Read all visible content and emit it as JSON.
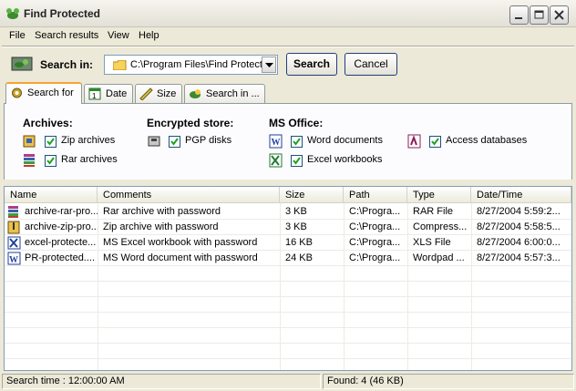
{
  "window": {
    "title": "Find Protected"
  },
  "menu": {
    "file": "File",
    "search_results": "Search results",
    "view": "View",
    "help": "Help"
  },
  "search": {
    "label": "Search in:",
    "path": "C:\\Program Files\\Find Protected",
    "search_button": "Search",
    "cancel_button": "Cancel"
  },
  "tabs": [
    {
      "label": "Search for",
      "icon": "gear-icon",
      "active": true
    },
    {
      "label": "Date",
      "icon": "calendar-icon",
      "active": false
    },
    {
      "label": "Size",
      "icon": "ruler-icon",
      "active": false
    },
    {
      "label": "Search in ...",
      "icon": "folder-search-icon",
      "active": false
    }
  ],
  "groups": {
    "archives": {
      "title": "Archives:",
      "items": [
        {
          "label": "Zip archives",
          "checked": true,
          "icon": "zip-archive-icon"
        },
        {
          "label": "Rar archives",
          "checked": true,
          "icon": "rar-archive-icon"
        }
      ]
    },
    "encrypted": {
      "title": "Encrypted store:",
      "items": [
        {
          "label": "PGP disks",
          "checked": true,
          "icon": "pgp-disk-icon"
        }
      ]
    },
    "office": {
      "title": "MS Office:",
      "items": [
        {
          "label": "Word documents",
          "checked": true,
          "icon": "word-icon"
        },
        {
          "label": "Excel workbooks",
          "checked": true,
          "icon": "excel-icon"
        },
        {
          "label": "Access databases",
          "checked": true,
          "icon": "access-icon"
        }
      ]
    }
  },
  "table": {
    "columns": [
      "Name",
      "Comments",
      "Size",
      "Path",
      "Type",
      "Date/Time"
    ],
    "rows": [
      {
        "name": "archive-rar-pro...",
        "comments": "Rar archive with password",
        "size": "3 KB",
        "path": "C:\\Progra...",
        "type": "RAR File",
        "datetime": "8/27/2004 5:59:2...",
        "icon": "rar-file-icon"
      },
      {
        "name": "archive-zip-pro...",
        "comments": "Zip archive with password",
        "size": "3 KB",
        "path": "C:\\Progra...",
        "type": "Compress...",
        "datetime": "8/27/2004 5:58:5...",
        "icon": "zip-file-icon"
      },
      {
        "name": "excel-protecte...",
        "comments": "MS Excel workbook with password",
        "size": "16 KB",
        "path": "C:\\Progra...",
        "type": "XLS File",
        "datetime": "8/27/2004 6:00:0...",
        "icon": "excel-file-icon"
      },
      {
        "name": "PR-protected....",
        "comments": "MS Word document with password",
        "size": "24 KB",
        "path": "C:\\Progra...",
        "type": "Wordpad ...",
        "datetime": "8/27/2004 5:57:3...",
        "icon": "word-file-icon"
      }
    ]
  },
  "status": {
    "search_time": "Search time : 12:00:00 AM",
    "found": "Found: 4  (46 KB)"
  },
  "colors": {
    "accent": "#f5a430",
    "window_bg": "#ece9d8",
    "border_blue": "#7f9db9"
  }
}
